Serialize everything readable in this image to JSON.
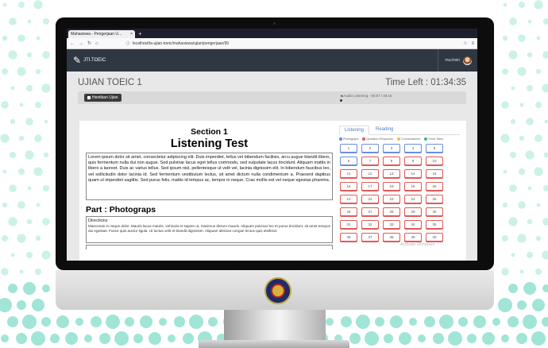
{
  "browser": {
    "tab_title": "Mahasiswa - Pengerjaan U...",
    "url": "localhost/ta-ujian-toeic/mahasiswa/ujian/pengerjaan/90"
  },
  "app": {
    "brand": "JTI.TOEIC",
    "user_name": "muchsin"
  },
  "exam": {
    "title": "UJIAN TOEIC 1",
    "time_left": "Time Left : 01:34:35",
    "stop_button": "Hentikan Ujian",
    "audio_status": "Audio Listening - 00:57 / 48:16"
  },
  "left_panel": {
    "section": "Section 1",
    "heading": "Listening Test",
    "paragraph": "Lorem ipsum dolor sit amet, consectetur adipiscing elit. Duis imperdiet, tellus vel bibendum facilisis, arcu augue blandit libero, quis fermentum nulla dui non augue. Sed pulvinar lacus eget tellus commodo, sed vulputate lacus tincidunt. Aliquam mattis in libero a laoreet. Duis ac varius tellus. Sed ipsum nisl, pellentesque ut velit vel, lacinia dignissim elit. In bibendum faucibus leo, vel sollicitudin dolor lacinia id. Sed fermentum vestibulum lectus, sit amet dictum nulla condimentum a. Praesent dapibus quam ut imperdiet sagittis. Sed purus felis, mattis id tempus ac, tempor in neque. Cras mollis est vel neque egestas pharetra.",
    "part_title": "Part : Photograps",
    "directions_label": "Directions",
    "directions_text": "Maecenas in neque dolor. Mauris lacus mauris, vehicula et sapien ut, maximus dictum mauris. Aliquam pulvinar leo et purus tincidunt, sit amet tempus dui egestas. Fusce quis auctor ligula. Ut luctus velit et blandit dignissim. Aliquam ultricies congue lectus quis eleifend."
  },
  "right_panel": {
    "tabs": [
      "Listening",
      "Reading"
    ],
    "legend": [
      {
        "label": "Photograps",
        "color": "#5b8def"
      },
      {
        "label": "Question-Response",
        "color": "#e05a5a"
      },
      {
        "label": "Conversations",
        "color": "#f0c23b"
      },
      {
        "label": "Short Talks",
        "color": "#3cb878"
      }
    ],
    "questions": [
      {
        "n": "1",
        "c": "blue"
      },
      {
        "n": "2",
        "c": "blue"
      },
      {
        "n": "3",
        "c": "blue"
      },
      {
        "n": "4",
        "c": "blue"
      },
      {
        "n": "5",
        "c": "blue"
      },
      {
        "n": "6",
        "c": "blue"
      },
      {
        "n": "7",
        "c": "red"
      },
      {
        "n": "8",
        "c": "red"
      },
      {
        "n": "9",
        "c": "red"
      },
      {
        "n": "10",
        "c": "red"
      },
      {
        "n": "11",
        "c": "red"
      },
      {
        "n": "12",
        "c": "red"
      },
      {
        "n": "13",
        "c": "red"
      },
      {
        "n": "14",
        "c": "red"
      },
      {
        "n": "15",
        "c": "red"
      },
      {
        "n": "16",
        "c": "red"
      },
      {
        "n": "17",
        "c": "red"
      },
      {
        "n": "18",
        "c": "red"
      },
      {
        "n": "19",
        "c": "red"
      },
      {
        "n": "20",
        "c": "red"
      },
      {
        "n": "21",
        "c": "red"
      },
      {
        "n": "22",
        "c": "red"
      },
      {
        "n": "23",
        "c": "red"
      },
      {
        "n": "24",
        "c": "red"
      },
      {
        "n": "25",
        "c": "red"
      },
      {
        "n": "26",
        "c": "red"
      },
      {
        "n": "27",
        "c": "red"
      },
      {
        "n": "28",
        "c": "red"
      },
      {
        "n": "29",
        "c": "red"
      },
      {
        "n": "30",
        "c": "red"
      },
      {
        "n": "31",
        "c": "red"
      },
      {
        "n": "32",
        "c": "red"
      },
      {
        "n": "33",
        "c": "red"
      },
      {
        "n": "34",
        "c": "red"
      },
      {
        "n": "35",
        "c": "red"
      },
      {
        "n": "36",
        "c": "red"
      },
      {
        "n": "37",
        "c": "red"
      },
      {
        "n": "38",
        "c": "red"
      },
      {
        "n": "39",
        "c": "red"
      },
      {
        "n": "40",
        "c": "red"
      }
    ]
  },
  "watermark": "Activate Windows",
  "colors": {
    "accent_dots": "#8fe0cf",
    "appbar": "#2f3742"
  }
}
